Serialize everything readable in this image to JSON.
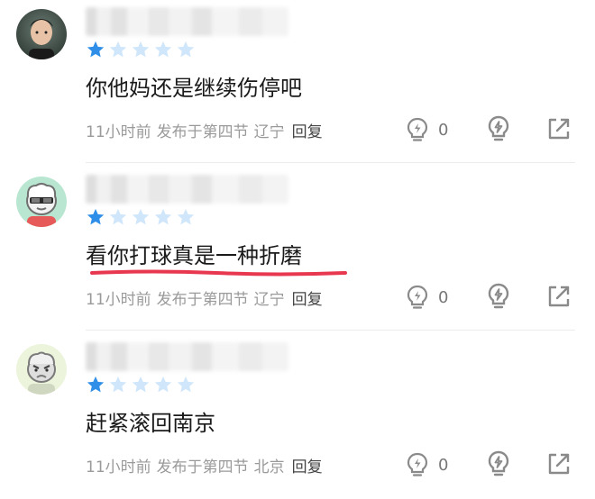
{
  "comments": [
    {
      "rating": 1,
      "max_rating": 5,
      "text": "你他妈还是继续伤停吧",
      "time": "11小时前",
      "posted_in": "发布于第四节",
      "location": "辽宁",
      "reply_label": "回复",
      "likes": "0",
      "avatar": "user-photo-avatar"
    },
    {
      "rating": 1,
      "max_rating": 5,
      "text": "看你打球真是一种折磨",
      "time": "11小时前",
      "posted_in": "发布于第四节",
      "location": "辽宁",
      "reply_label": "回复",
      "likes": "0",
      "avatar": "cartoon-sunglasses-avatar"
    },
    {
      "rating": 1,
      "max_rating": 5,
      "text": "赶紧滚回南京",
      "time": "11小时前",
      "posted_in": "发布于第四节",
      "location": "北京",
      "reply_label": "回复",
      "likes": "0",
      "avatar": "cartoon-angry-avatar"
    }
  ],
  "colors": {
    "star_filled": "#2f8fe8",
    "star_empty": "#cfe6fb",
    "meta_text": "#9a9a9a",
    "underline_mark": "#e8384f",
    "icon_stroke": "#8a8a8a"
  },
  "icons": {
    "like": "lightbulb-bolt-icon",
    "action": "bulb-icon",
    "open": "external-link-icon"
  }
}
